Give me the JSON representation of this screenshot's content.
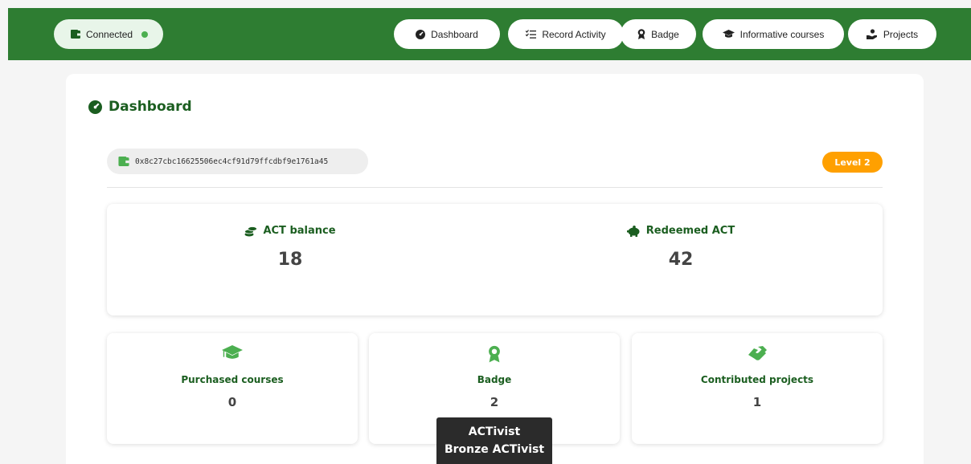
{
  "nav": {
    "connected": {
      "label": "Connected",
      "status_color": "#4caf50"
    },
    "items": [
      {
        "label": "Dashboard",
        "icon": "gauge-icon"
      },
      {
        "label": "Record Activity",
        "icon": "checklist-icon"
      },
      {
        "label": "Badge",
        "icon": "award-icon"
      },
      {
        "label": "Informative courses",
        "icon": "graduation-cap-icon"
      },
      {
        "label": "Projects",
        "icon": "hand-holding-icon"
      }
    ]
  },
  "dashboard": {
    "title": "Dashboard",
    "wallet_address": "0x8c27cbc16625506ec4cf91d79ffcdbf9e1761a45",
    "level": "Level 2",
    "level_color": "#ffa000"
  },
  "balances": {
    "act_balance": {
      "label": "ACT balance",
      "value": "18"
    },
    "redeemed": {
      "label": "Redeemed ACT",
      "value": "42"
    }
  },
  "stats": [
    {
      "label": "Purchased courses",
      "value": "0",
      "icon": "graduation-cap-icon"
    },
    {
      "label": "Badge",
      "value": "2",
      "icon": "award-icon"
    },
    {
      "label": "Contributed projects",
      "value": "1",
      "icon": "handshake-icon"
    }
  ],
  "tooltip": {
    "lines": [
      "ACTivist",
      "Bronze ACTivist"
    ]
  },
  "colors": {
    "brand": "#2e7d32",
    "accent": "#4caf50",
    "heading": "#1b5e20"
  }
}
